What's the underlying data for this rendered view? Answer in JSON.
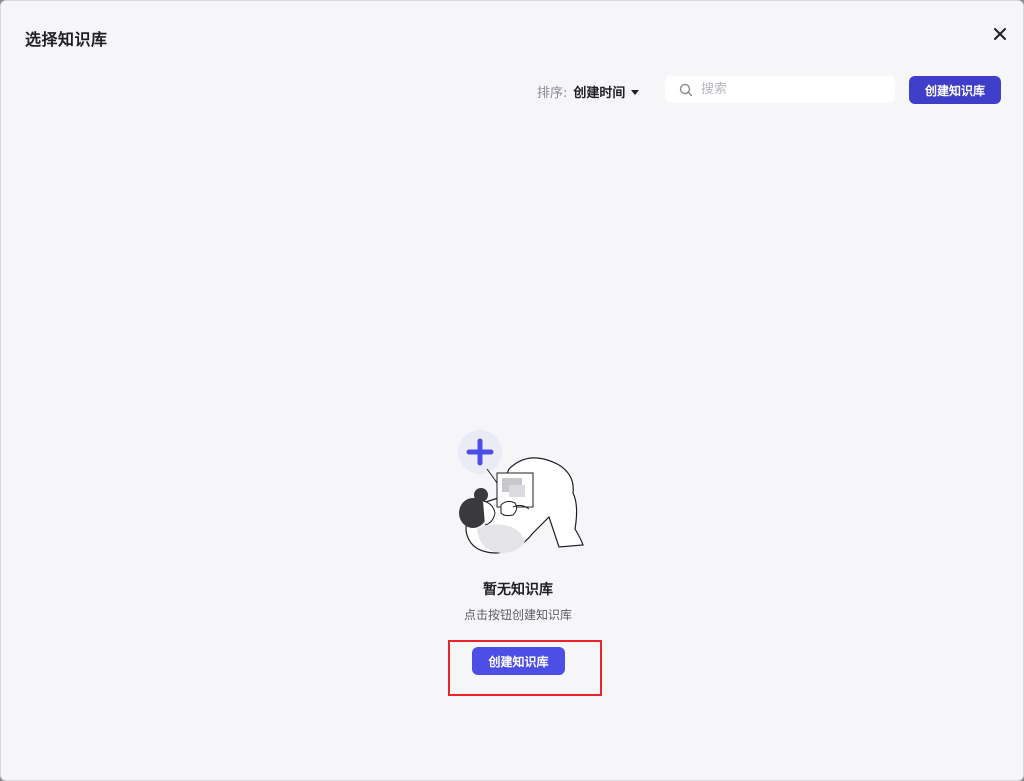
{
  "modal": {
    "title": "选择知识库"
  },
  "toolbar": {
    "sort_label": "排序:",
    "sort_value": "创建时间",
    "search_placeholder": "搜索",
    "create_button_label": "创建知识库"
  },
  "empty_state": {
    "title": "暂无知识库",
    "subtitle": "点击按钮创建知识库",
    "create_button_label": "创建知识库"
  },
  "icons": {
    "close": "close-icon",
    "search": "search-icon",
    "sort_caret": "caret-down-icon",
    "illustration": "empty-knowledge-base-illustration",
    "plus": "plus-icon"
  },
  "colors": {
    "primary": "#3f3ec9",
    "primary_light": "#4d4ee6",
    "highlight": "#e8242b",
    "background": "#f6f6f9"
  }
}
